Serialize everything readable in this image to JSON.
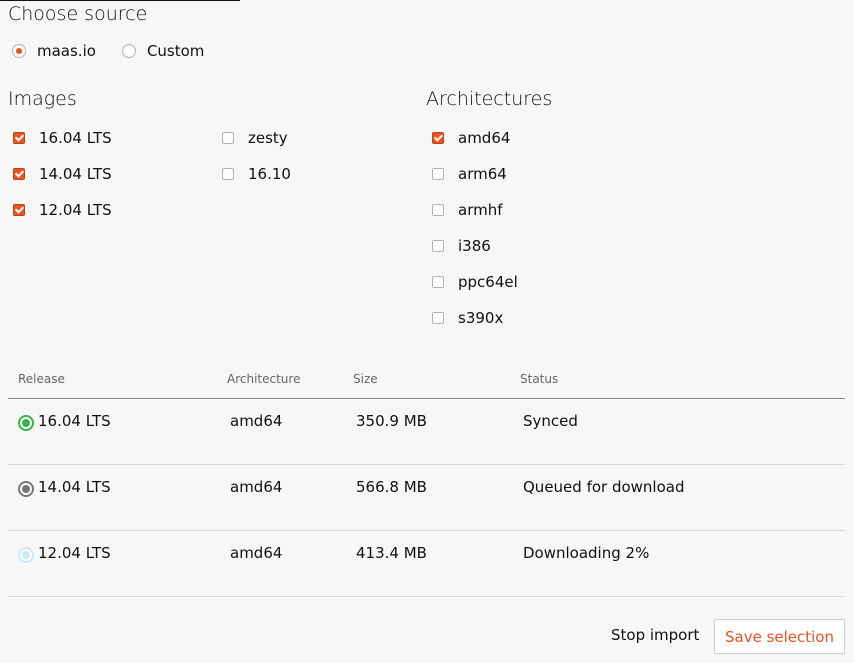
{
  "source": {
    "title": "Choose source",
    "options": [
      {
        "label": "maas.io",
        "selected": true
      },
      {
        "label": "Custom",
        "selected": false
      }
    ]
  },
  "images": {
    "title": "Images",
    "items": [
      {
        "label": "16.04 LTS",
        "checked": true
      },
      {
        "label": "14.04 LTS",
        "checked": true
      },
      {
        "label": "12.04 LTS",
        "checked": true
      },
      {
        "label": "zesty",
        "checked": false
      },
      {
        "label": "16.10",
        "checked": false
      }
    ]
  },
  "architectures": {
    "title": "Architectures",
    "items": [
      {
        "label": "amd64",
        "checked": true
      },
      {
        "label": "arm64",
        "checked": false
      },
      {
        "label": "armhf",
        "checked": false
      },
      {
        "label": "i386",
        "checked": false
      },
      {
        "label": "ppc64el",
        "checked": false
      },
      {
        "label": "s390x",
        "checked": false
      }
    ]
  },
  "table": {
    "headers": [
      "Release",
      "Architecture",
      "Size",
      "Status"
    ],
    "rows": [
      {
        "release": "16.04 LTS",
        "architecture": "amd64",
        "size": "350.9 MB",
        "status": "Synced",
        "state_icon": "synced-icon",
        "state_color": "#38b44a"
      },
      {
        "release": "14.04 LTS",
        "architecture": "amd64",
        "size": "566.8 MB",
        "status": "Queued for download",
        "state_icon": "queued-icon",
        "state_color": "#777777"
      },
      {
        "release": "12.04 LTS",
        "architecture": "amd64",
        "size": "413.4 MB",
        "status": "Downloading 2%",
        "state_icon": "downloading-icon",
        "state_color": "#cfe8f3"
      }
    ]
  },
  "actions": {
    "stop_label": "Stop import",
    "save_label": "Save selection"
  },
  "colors": {
    "accent": "#e95420"
  }
}
